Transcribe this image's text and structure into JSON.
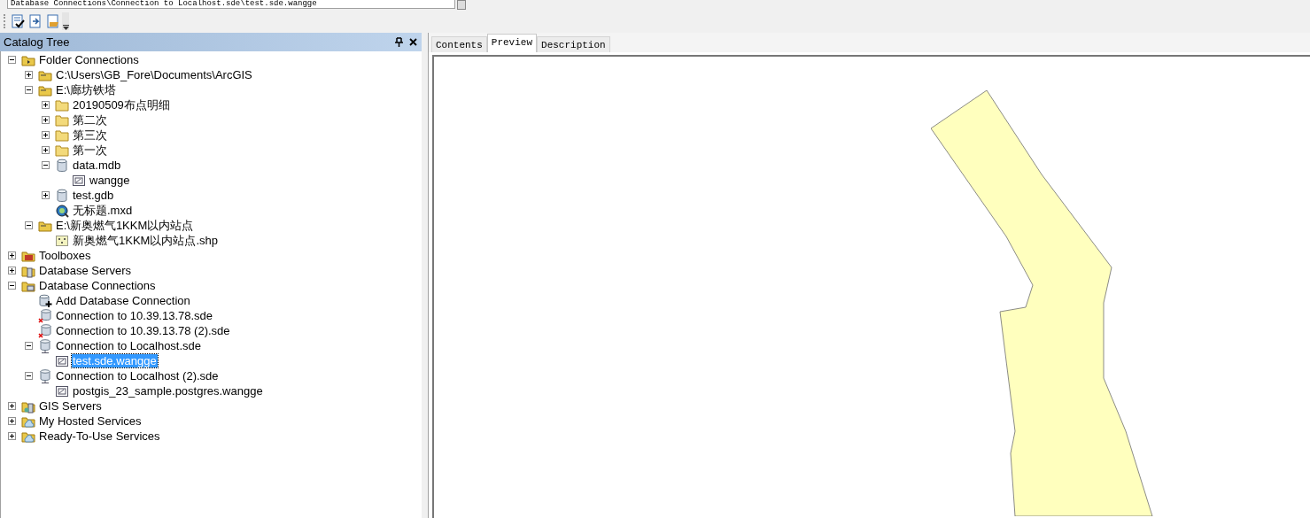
{
  "location": {
    "value": "Database Connections\\Connection to Localhost.sde\\test.sde.wangge"
  },
  "toolbar": {
    "buttons": [
      {
        "kind": "check"
      },
      {
        "kind": "export"
      },
      {
        "kind": "metadata"
      }
    ]
  },
  "catalog": {
    "title": "Catalog Tree",
    "tree": [
      {
        "label": "Folder Connections",
        "kind": "folder-connections",
        "expanded": true,
        "selected": false,
        "children": [
          {
            "label": "C:\\Users\\GB_Fore\\Documents\\ArcGIS",
            "kind": "folder-link",
            "expanded": false,
            "selected": false
          },
          {
            "label": "E:\\廊坊铁塔",
            "kind": "folder-link",
            "expanded": true,
            "selected": false,
            "children": [
              {
                "label": "20190509布点明细",
                "kind": "folder",
                "expanded": false,
                "selected": false
              },
              {
                "label": "第二次",
                "kind": "folder",
                "expanded": false,
                "selected": false
              },
              {
                "label": "第三次",
                "kind": "folder",
                "expanded": false,
                "selected": false
              },
              {
                "label": "第一次",
                "kind": "folder",
                "expanded": false,
                "selected": false
              },
              {
                "label": "data.mdb",
                "kind": "database",
                "expanded": true,
                "selected": false,
                "children": [
                  {
                    "label": "wangge",
                    "kind": "feature-class",
                    "selected": false
                  }
                ]
              },
              {
                "label": "test.gdb",
                "kind": "database",
                "expanded": false,
                "selected": false
              },
              {
                "label": "无标题.mxd",
                "kind": "map-document",
                "selected": false
              }
            ]
          },
          {
            "label": "E:\\新奥燃气1KKM以内站点",
            "kind": "folder-link",
            "expanded": true,
            "selected": false,
            "children": [
              {
                "label": "新奥燃气1KKM以内站点.shp",
                "kind": "shapefile",
                "selected": false
              }
            ]
          }
        ]
      },
      {
        "label": "Toolboxes",
        "kind": "toolbox",
        "expanded": false,
        "selected": false
      },
      {
        "label": "Database Servers",
        "kind": "db-servers",
        "expanded": false,
        "selected": false
      },
      {
        "label": "Database Connections",
        "kind": "db-connections",
        "expanded": true,
        "selected": false,
        "children": [
          {
            "label": "Add Database Connection",
            "kind": "add-connection",
            "selected": false
          },
          {
            "label": "Connection to 10.39.13.78.sde",
            "kind": "sde-broken",
            "selected": false
          },
          {
            "label": "Connection to 10.39.13.78 (2).sde",
            "kind": "sde-broken",
            "selected": false
          },
          {
            "label": "Connection to Localhost.sde",
            "kind": "sde",
            "expanded": true,
            "selected": false,
            "children": [
              {
                "label": "test.sde.wangge",
                "kind": "feature-class",
                "selected": true
              }
            ]
          },
          {
            "label": "Connection to Localhost (2).sde",
            "kind": "sde",
            "expanded": true,
            "selected": false,
            "children": [
              {
                "label": "postgis_23_sample.postgres.wangge",
                "kind": "feature-class",
                "selected": false
              }
            ]
          }
        ]
      },
      {
        "label": "GIS Servers",
        "kind": "gis-servers",
        "expanded": false,
        "selected": false
      },
      {
        "label": "My Hosted Services",
        "kind": "cloud-folder",
        "expanded": false,
        "selected": false
      },
      {
        "label": "Ready-To-Use Services",
        "kind": "cloud-folder",
        "expanded": false,
        "selected": false
      }
    ]
  },
  "tabs": [
    {
      "label": "Contents",
      "selected": false
    },
    {
      "label": "Preview",
      "selected": true
    },
    {
      "label": "Description",
      "selected": false
    }
  ],
  "preview": {
    "kind": "polygon"
  }
}
